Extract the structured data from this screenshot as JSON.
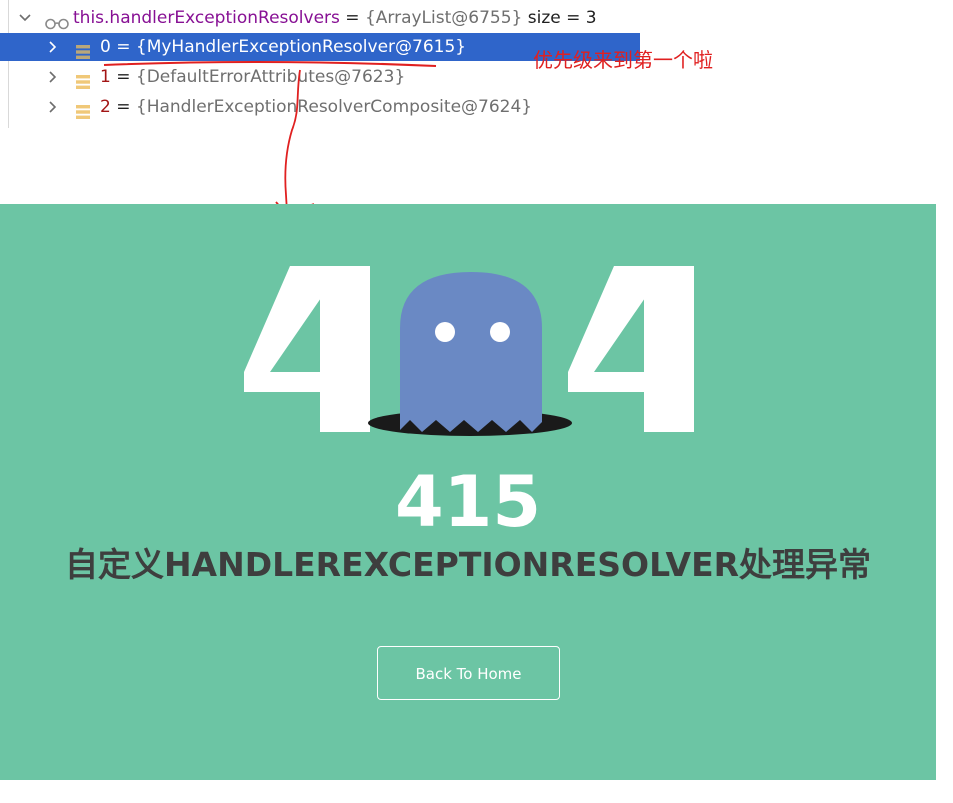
{
  "debugger": {
    "root": {
      "name": "this.handlerExceptionResolvers",
      "eq": " = ",
      "value": "{ArrayList@6755}",
      "size": "size = 3"
    },
    "items": [
      {
        "index": "0",
        "eq": " = ",
        "value": "{MyHandlerExceptionResolver@7615}",
        "selected": true
      },
      {
        "index": "1",
        "eq": " = ",
        "value": "{DefaultErrorAttributes@7623}",
        "selected": false
      },
      {
        "index": "2",
        "eq": " = ",
        "value": "{HandlerExceptionResolverComposite@7624}",
        "selected": false
      }
    ],
    "annotation": "优先级来到第一个啦",
    "annotation_color": "#e02020",
    "selection_color": "#2f65ca"
  },
  "error_page": {
    "big_text": "404",
    "status_code": "415",
    "message": "自定义HANDLEREXCEPTIONRESOLVER处理异常",
    "back_button": "Back To Home",
    "background_color": "#6cc5a4",
    "ghost_color": "#6a89c4"
  }
}
